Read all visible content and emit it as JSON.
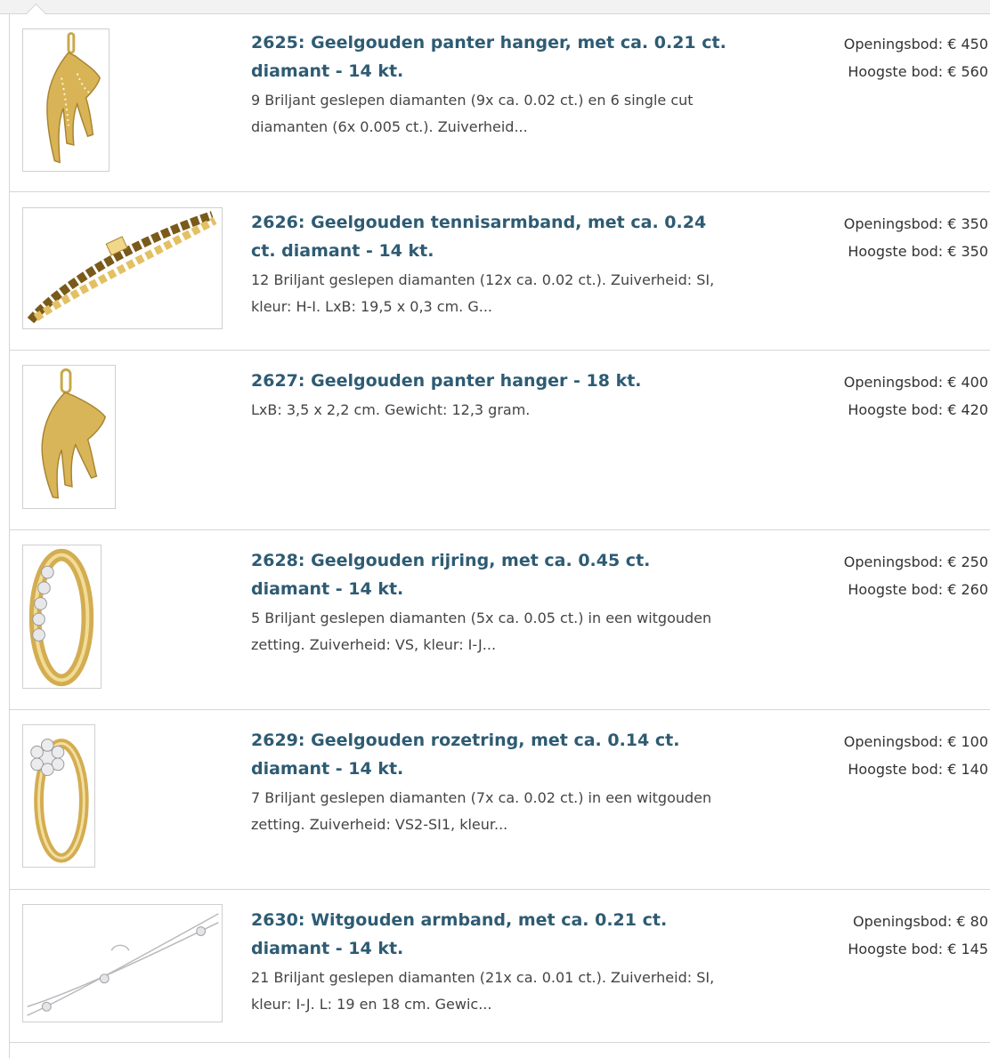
{
  "lots": [
    {
      "title": "2625: Geelgouden panter hanger, met ca. 0.21 ct. diamant - 14 kt.",
      "description": "9 Briljant geslepen diamanten (9x ca. 0.02 ct.) en 6 single cut diamanten (6x 0.005 ct.). Zuiverheid...",
      "opening_bid": "Openingsbod: € 450",
      "highest_bid": "Hoogste bod: € 560",
      "image": "gold-panther-pendant-diamonds"
    },
    {
      "title": "2626: Geelgouden tennisarmband, met ca. 0.24 ct. diamant - 14 kt.",
      "description": "12 Briljant geslepen diamanten (12x ca. 0.02 ct.). Zuiverheid: SI, kleur: H-I. LxB: 19,5 x 0,3 cm. G...",
      "opening_bid": "Openingsbod: € 350",
      "highest_bid": "Hoogste bod: € 350",
      "image": "gold-tennis-bracelet"
    },
    {
      "title": "2627: Geelgouden panter hanger - 18 kt.",
      "description": "LxB: 3,5 x 2,2 cm. Gewicht: 12,3 gram.",
      "opening_bid": "Openingsbod: € 400",
      "highest_bid": "Hoogste bod: € 420",
      "image": "gold-panther-pendant"
    },
    {
      "title": "2628: Geelgouden rijring, met ca. 0.45 ct. diamant - 14 kt.",
      "description": "5 Briljant geslepen diamanten (5x ca. 0.05 ct.) in een witgouden zetting. Zuiverheid: VS, kleur: I-J...",
      "opening_bid": "Openingsbod: € 250",
      "highest_bid": "Hoogste bod: € 260",
      "image": "gold-eternity-ring"
    },
    {
      "title": "2629: Geelgouden rozetring, met ca. 0.14 ct. diamant - 14 kt.",
      "description": "7 Briljant geslepen diamanten (7x ca. 0.02 ct.) in een witgouden zetting. Zuiverheid: VS2-SI1, kleur...",
      "opening_bid": "Openingsbod: € 100",
      "highest_bid": "Hoogste bod: € 140",
      "image": "gold-rosette-ring"
    },
    {
      "title": "2630: Witgouden armband, met ca. 0.21 ct. diamant - 14 kt.",
      "description": "21 Briljant geslepen diamanten (21x ca. 0.01 ct.). Zuiverheid: SI, kleur: I-J. L: 19 en 18 cm. Gewic...",
      "opening_bid": "Openingsbod: € 80",
      "highest_bid": "Hoogste bod: € 145",
      "image": "white-gold-bracelet"
    }
  ]
}
